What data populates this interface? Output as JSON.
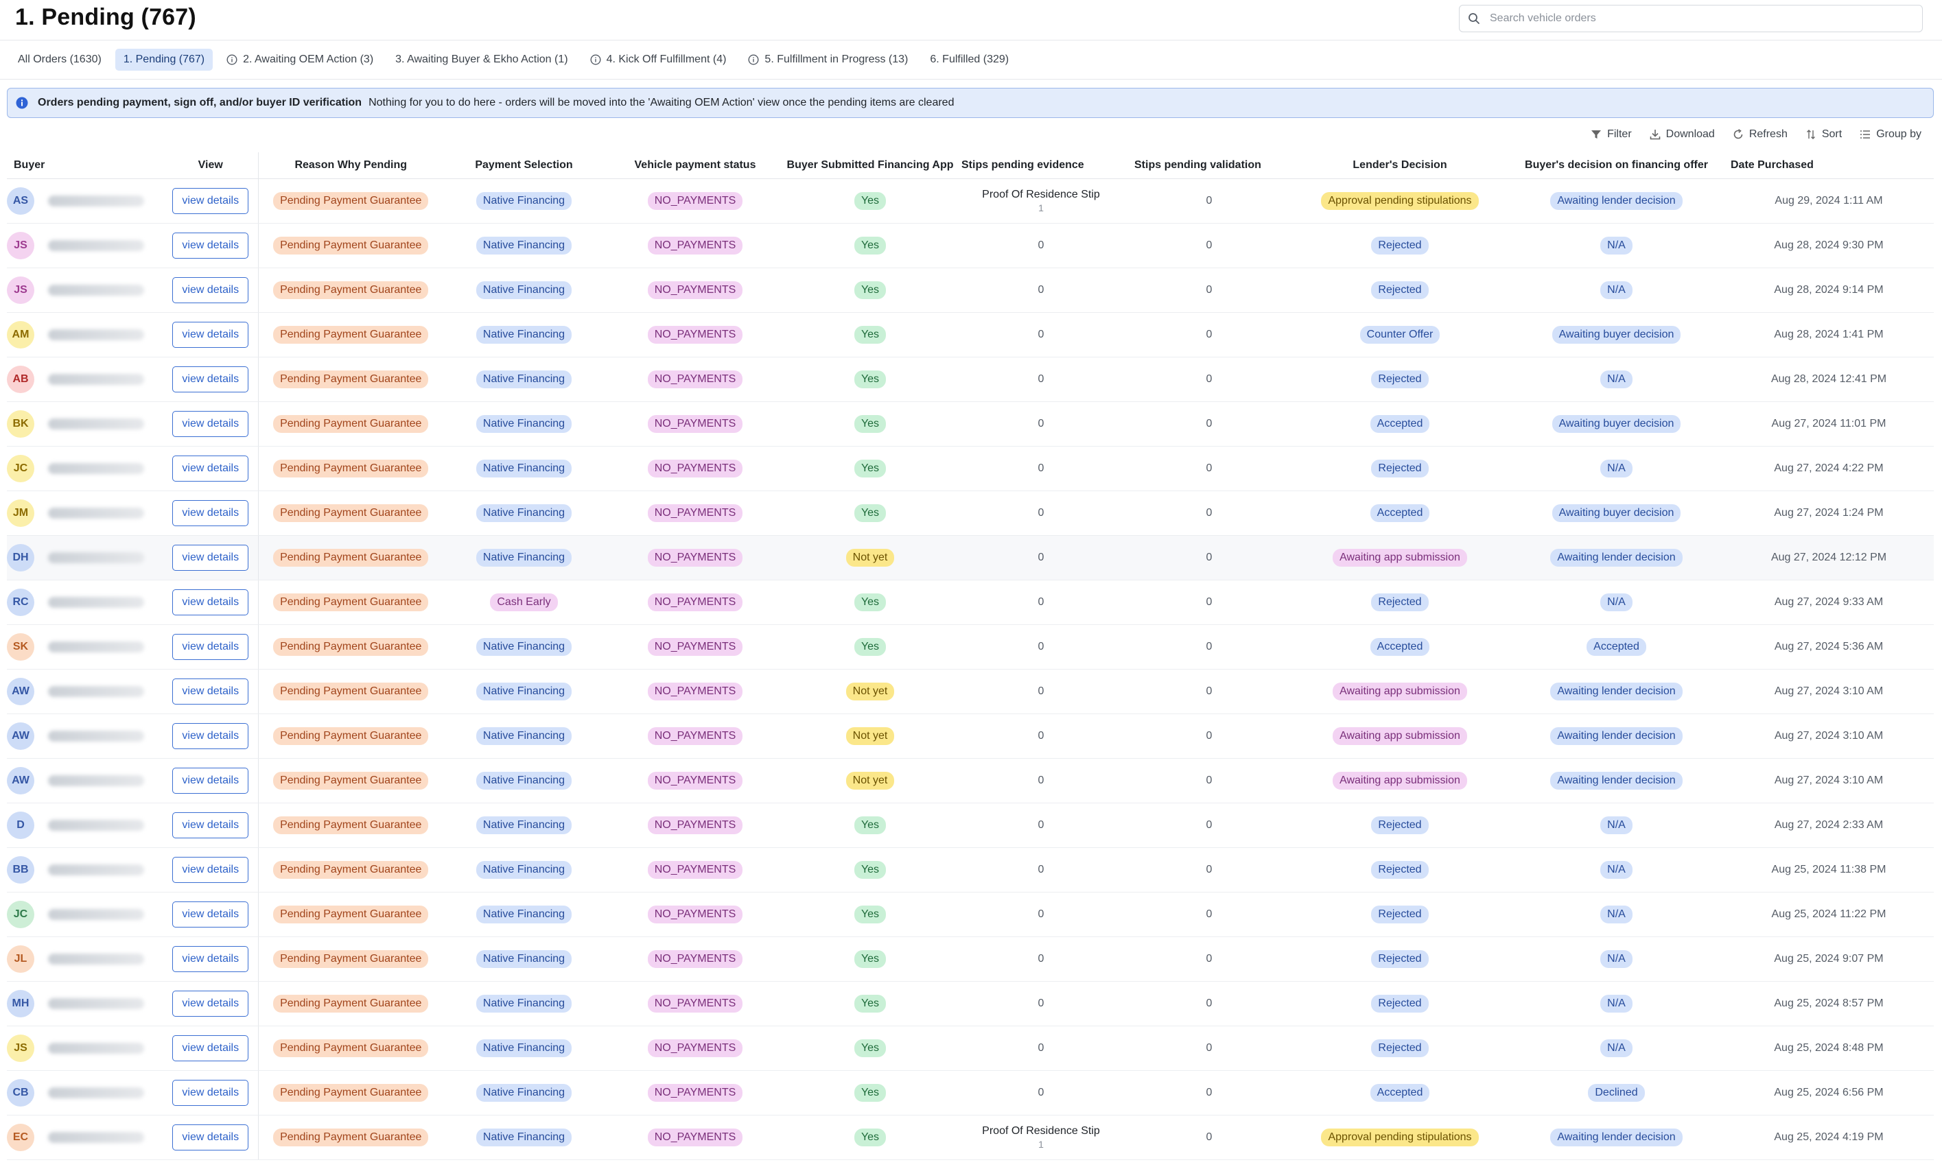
{
  "page": {
    "title": "1. Pending (767)"
  },
  "search": {
    "placeholder": "Search vehicle orders",
    "value": ""
  },
  "tabs": [
    {
      "label": "All Orders (1630)",
      "active": false,
      "icon": ""
    },
    {
      "label": "1. Pending (767)",
      "active": true,
      "icon": ""
    },
    {
      "label": "2. Awaiting OEM Action (3)",
      "active": false,
      "icon": "info-icon"
    },
    {
      "label": "3. Awaiting Buyer & Ekho Action (1)",
      "active": false,
      "icon": ""
    },
    {
      "label": "4. Kick Off Fulfillment (4)",
      "active": false,
      "icon": "info-icon"
    },
    {
      "label": "5. Fulfillment in Progress (13)",
      "active": false,
      "icon": "info-icon"
    },
    {
      "label": "6. Fulfilled (329)",
      "active": false,
      "icon": ""
    }
  ],
  "banner": {
    "title": "Orders pending payment, sign off, and/or buyer ID verification",
    "message": "Nothing for you to do here - orders will be moved into the 'Awaiting OEM Action' view once the pending items are cleared",
    "icon": "info-icon",
    "color": "#e3ecfb"
  },
  "toolbar": {
    "filter": "Filter",
    "download": "Download",
    "refresh": "Refresh",
    "sort": "Sort",
    "group_by": "Group by"
  },
  "table": {
    "columns": [
      "Buyer",
      "View",
      "Reason Why Pending",
      "Payment Selection",
      "Vehicle payment status",
      "Buyer Submitted Financing App",
      "Stips pending evidence",
      "Stips pending validation",
      "Lender's Decision",
      "Buyer's decision on financing offer",
      "Date Purchased"
    ],
    "view_label": "view details",
    "rows": [
      {
        "initials": "AS",
        "avatar": "blue",
        "reason": "Pending Payment Guarantee",
        "payment": "Native Financing",
        "payment_color": "blue",
        "status": "NO_PAYMENTS",
        "submitted": "Yes",
        "submitted_color": "green",
        "stips_evidence": "Proof Of Residence Stip",
        "stips_evidence_count": "1",
        "stips_validation": "0",
        "lender": "Approval pending stipulations",
        "lender_color": "yellow",
        "buyer_decision": "Awaiting lender decision",
        "date": "Aug 29, 2024 1:11 AM"
      },
      {
        "initials": "JS",
        "avatar": "pink",
        "reason": "Pending Payment Guarantee",
        "payment": "Native Financing",
        "payment_color": "blue",
        "status": "NO_PAYMENTS",
        "submitted": "Yes",
        "submitted_color": "green",
        "stips_evidence": "0",
        "stips_evidence_count": "",
        "stips_validation": "0",
        "lender": "Rejected",
        "lender_color": "blue",
        "buyer_decision": "N/A",
        "date": "Aug 28, 2024 9:30 PM"
      },
      {
        "initials": "JS",
        "avatar": "pink",
        "reason": "Pending Payment Guarantee",
        "payment": "Native Financing",
        "payment_color": "blue",
        "status": "NO_PAYMENTS",
        "submitted": "Yes",
        "submitted_color": "green",
        "stips_evidence": "0",
        "stips_evidence_count": "",
        "stips_validation": "0",
        "lender": "Rejected",
        "lender_color": "blue",
        "buyer_decision": "N/A",
        "date": "Aug 28, 2024 9:14 PM"
      },
      {
        "initials": "AM",
        "avatar": "yellow",
        "reason": "Pending Payment Guarantee",
        "payment": "Native Financing",
        "payment_color": "blue",
        "status": "NO_PAYMENTS",
        "submitted": "Yes",
        "submitted_color": "green",
        "stips_evidence": "0",
        "stips_evidence_count": "",
        "stips_validation": "0",
        "lender": "Counter Offer",
        "lender_color": "blue",
        "buyer_decision": "Awaiting buyer decision",
        "date": "Aug 28, 2024 1:41 PM"
      },
      {
        "initials": "AB",
        "avatar": "red",
        "reason": "Pending Payment Guarantee",
        "payment": "Native Financing",
        "payment_color": "blue",
        "status": "NO_PAYMENTS",
        "submitted": "Yes",
        "submitted_color": "green",
        "stips_evidence": "0",
        "stips_evidence_count": "",
        "stips_validation": "0",
        "lender": "Rejected",
        "lender_color": "blue",
        "buyer_decision": "N/A",
        "date": "Aug 28, 2024 12:41 PM"
      },
      {
        "initials": "BK",
        "avatar": "yellow",
        "reason": "Pending Payment Guarantee",
        "payment": "Native Financing",
        "payment_color": "blue",
        "status": "NO_PAYMENTS",
        "submitted": "Yes",
        "submitted_color": "green",
        "stips_evidence": "0",
        "stips_evidence_count": "",
        "stips_validation": "0",
        "lender": "Accepted",
        "lender_color": "blue",
        "buyer_decision": "Awaiting buyer decision",
        "date": "Aug 27, 2024 11:01 PM"
      },
      {
        "initials": "JC",
        "avatar": "yellow",
        "reason": "Pending Payment Guarantee",
        "payment": "Native Financing",
        "payment_color": "blue",
        "status": "NO_PAYMENTS",
        "submitted": "Yes",
        "submitted_color": "green",
        "stips_evidence": "0",
        "stips_evidence_count": "",
        "stips_validation": "0",
        "lender": "Rejected",
        "lender_color": "blue",
        "buyer_decision": "N/A",
        "date": "Aug 27, 2024 4:22 PM"
      },
      {
        "initials": "JM",
        "avatar": "yellow",
        "reason": "Pending Payment Guarantee",
        "payment": "Native Financing",
        "payment_color": "blue",
        "status": "NO_PAYMENTS",
        "submitted": "Yes",
        "submitted_color": "green",
        "stips_evidence": "0",
        "stips_evidence_count": "",
        "stips_validation": "0",
        "lender": "Accepted",
        "lender_color": "blue",
        "buyer_decision": "Awaiting buyer decision",
        "date": "Aug 27, 2024 1:24 PM"
      },
      {
        "initials": "DH",
        "avatar": "blue",
        "reason": "Pending Payment Guarantee",
        "payment": "Native Financing",
        "payment_color": "blue",
        "status": "NO_PAYMENTS",
        "submitted": "Not yet",
        "submitted_color": "yellow",
        "stips_evidence": "0",
        "stips_evidence_count": "",
        "stips_validation": "0",
        "lender": "Awaiting app submission",
        "lender_color": "purple",
        "buyer_decision": "Awaiting lender decision",
        "date": "Aug 27, 2024 12:12 PM"
      },
      {
        "initials": "RC",
        "avatar": "blue",
        "reason": "Pending Payment Guarantee",
        "payment": "Cash Early",
        "payment_color": "purple",
        "status": "NO_PAYMENTS",
        "submitted": "Yes",
        "submitted_color": "green",
        "stips_evidence": "0",
        "stips_evidence_count": "",
        "stips_validation": "0",
        "lender": "Rejected",
        "lender_color": "blue",
        "buyer_decision": "N/A",
        "date": "Aug 27, 2024 9:33 AM"
      },
      {
        "initials": "SK",
        "avatar": "orange",
        "reason": "Pending Payment Guarantee",
        "payment": "Native Financing",
        "payment_color": "blue",
        "status": "NO_PAYMENTS",
        "submitted": "Yes",
        "submitted_color": "green",
        "stips_evidence": "0",
        "stips_evidence_count": "",
        "stips_validation": "0",
        "lender": "Accepted",
        "lender_color": "blue",
        "buyer_decision": "Accepted",
        "date": "Aug 27, 2024 5:36 AM"
      },
      {
        "initials": "AW",
        "avatar": "blue",
        "reason": "Pending Payment Guarantee",
        "payment": "Native Financing",
        "payment_color": "blue",
        "status": "NO_PAYMENTS",
        "submitted": "Not yet",
        "submitted_color": "yellow",
        "stips_evidence": "0",
        "stips_evidence_count": "",
        "stips_validation": "0",
        "lender": "Awaiting app submission",
        "lender_color": "purple",
        "buyer_decision": "Awaiting lender decision",
        "date": "Aug 27, 2024 3:10 AM"
      },
      {
        "initials": "AW",
        "avatar": "blue",
        "reason": "Pending Payment Guarantee",
        "payment": "Native Financing",
        "payment_color": "blue",
        "status": "NO_PAYMENTS",
        "submitted": "Not yet",
        "submitted_color": "yellow",
        "stips_evidence": "0",
        "stips_evidence_count": "",
        "stips_validation": "0",
        "lender": "Awaiting app submission",
        "lender_color": "purple",
        "buyer_decision": "Awaiting lender decision",
        "date": "Aug 27, 2024 3:10 AM"
      },
      {
        "initials": "AW",
        "avatar": "blue",
        "reason": "Pending Payment Guarantee",
        "payment": "Native Financing",
        "payment_color": "blue",
        "status": "NO_PAYMENTS",
        "submitted": "Not yet",
        "submitted_color": "yellow",
        "stips_evidence": "0",
        "stips_evidence_count": "",
        "stips_validation": "0",
        "lender": "Awaiting app submission",
        "lender_color": "purple",
        "buyer_decision": "Awaiting lender decision",
        "date": "Aug 27, 2024 3:10 AM"
      },
      {
        "initials": "D",
        "avatar": "blue",
        "reason": "Pending Payment Guarantee",
        "payment": "Native Financing",
        "payment_color": "blue",
        "status": "NO_PAYMENTS",
        "submitted": "Yes",
        "submitted_color": "green",
        "stips_evidence": "0",
        "stips_evidence_count": "",
        "stips_validation": "0",
        "lender": "Rejected",
        "lender_color": "blue",
        "buyer_decision": "N/A",
        "date": "Aug 27, 2024 2:33 AM"
      },
      {
        "initials": "BB",
        "avatar": "blue",
        "reason": "Pending Payment Guarantee",
        "payment": "Native Financing",
        "payment_color": "blue",
        "status": "NO_PAYMENTS",
        "submitted": "Yes",
        "submitted_color": "green",
        "stips_evidence": "0",
        "stips_evidence_count": "",
        "stips_validation": "0",
        "lender": "Rejected",
        "lender_color": "blue",
        "buyer_decision": "N/A",
        "date": "Aug 25, 2024 11:38 PM"
      },
      {
        "initials": "JC",
        "avatar": "green",
        "reason": "Pending Payment Guarantee",
        "payment": "Native Financing",
        "payment_color": "blue",
        "status": "NO_PAYMENTS",
        "submitted": "Yes",
        "submitted_color": "green",
        "stips_evidence": "0",
        "stips_evidence_count": "",
        "stips_validation": "0",
        "lender": "Rejected",
        "lender_color": "blue",
        "buyer_decision": "N/A",
        "date": "Aug 25, 2024 11:22 PM"
      },
      {
        "initials": "JL",
        "avatar": "orange",
        "reason": "Pending Payment Guarantee",
        "payment": "Native Financing",
        "payment_color": "blue",
        "status": "NO_PAYMENTS",
        "submitted": "Yes",
        "submitted_color": "green",
        "stips_evidence": "0",
        "stips_evidence_count": "",
        "stips_validation": "0",
        "lender": "Rejected",
        "lender_color": "blue",
        "buyer_decision": "N/A",
        "date": "Aug 25, 2024 9:07 PM"
      },
      {
        "initials": "MH",
        "avatar": "blue",
        "reason": "Pending Payment Guarantee",
        "payment": "Native Financing",
        "payment_color": "blue",
        "status": "NO_PAYMENTS",
        "submitted": "Yes",
        "submitted_color": "green",
        "stips_evidence": "0",
        "stips_evidence_count": "",
        "stips_validation": "0",
        "lender": "Rejected",
        "lender_color": "blue",
        "buyer_decision": "N/A",
        "date": "Aug 25, 2024 8:57 PM"
      },
      {
        "initials": "JS",
        "avatar": "yellow",
        "reason": "Pending Payment Guarantee",
        "payment": "Native Financing",
        "payment_color": "blue",
        "status": "NO_PAYMENTS",
        "submitted": "Yes",
        "submitted_color": "green",
        "stips_evidence": "0",
        "stips_evidence_count": "",
        "stips_validation": "0",
        "lender": "Rejected",
        "lender_color": "blue",
        "buyer_decision": "N/A",
        "date": "Aug 25, 2024 8:48 PM"
      },
      {
        "initials": "CB",
        "avatar": "blue",
        "reason": "Pending Payment Guarantee",
        "payment": "Native Financing",
        "payment_color": "blue",
        "status": "NO_PAYMENTS",
        "submitted": "Yes",
        "submitted_color": "green",
        "stips_evidence": "0",
        "stips_evidence_count": "",
        "stips_validation": "0",
        "lender": "Accepted",
        "lender_color": "blue",
        "buyer_decision": "Declined",
        "date": "Aug 25, 2024 6:56 PM"
      },
      {
        "initials": "EC",
        "avatar": "orange",
        "reason": "Pending Payment Guarantee",
        "payment": "Native Financing",
        "payment_color": "blue",
        "status": "NO_PAYMENTS",
        "submitted": "Yes",
        "submitted_color": "green",
        "stips_evidence": "Proof Of Residence Stip",
        "stips_evidence_count": "1",
        "stips_validation": "0",
        "lender": "Approval pending stipulations",
        "lender_color": "yellow",
        "buyer_decision": "Awaiting lender decision",
        "date": "Aug 25, 2024 4:19 PM"
      }
    ]
  }
}
